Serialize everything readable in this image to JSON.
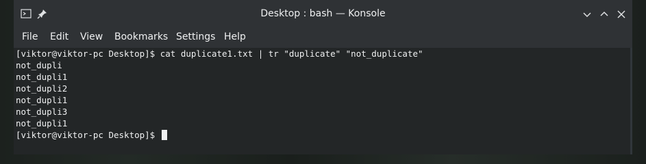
{
  "window": {
    "title": "Desktop : bash — Konsole",
    "titlebar_icons": [
      "konsole-icon",
      "pin-icon"
    ],
    "controls": [
      "minimize-icon",
      "maximize-icon",
      "close-icon"
    ]
  },
  "menu": {
    "items": [
      {
        "label": "File"
      },
      {
        "label": "Edit"
      },
      {
        "label": "View"
      },
      {
        "label": "Bookmarks"
      },
      {
        "label": "Settings"
      },
      {
        "label": "Help"
      }
    ]
  },
  "terminal": {
    "lines": [
      {
        "prompt": "[viktor@viktor-pc Desktop]$ ",
        "text": "cat duplicate1.txt | tr \"duplicate\" \"not_duplicate\""
      },
      {
        "text": "not_dupli"
      },
      {
        "text": "not_dupli1"
      },
      {
        "text": "not_dupli2"
      },
      {
        "text": "not_dupli1"
      },
      {
        "text": "not_dupli3"
      },
      {
        "text": "not_dupli1"
      },
      {
        "prompt": "[viktor@viktor-pc Desktop]$ ",
        "text": ""
      }
    ]
  },
  "colors": {
    "titlebar_bg": "#2f3235",
    "terminal_bg": "#232627",
    "text": "#eff0f1"
  }
}
